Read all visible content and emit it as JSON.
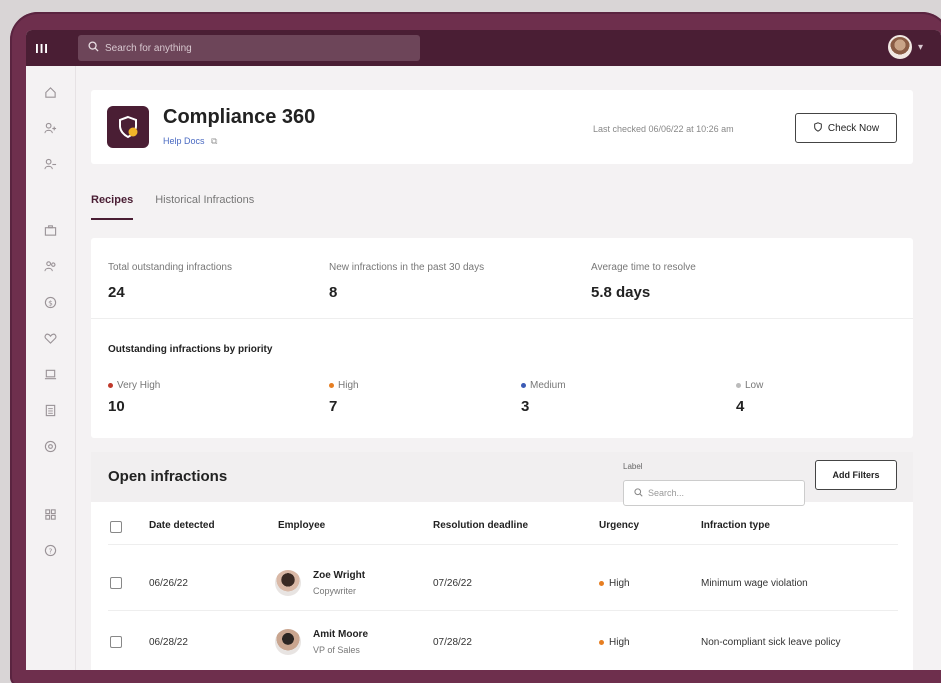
{
  "topbar": {
    "logo": "III",
    "search_placeholder": "Search for anything"
  },
  "sidebar": {
    "icons": [
      "home-icon",
      "add-person-icon",
      "remove-person-icon",
      "briefcase-icon",
      "people-icon",
      "dollar-icon",
      "heart-icon",
      "laptop-icon",
      "document-icon",
      "settings-icon",
      "reports-icon",
      "help-icon"
    ]
  },
  "header": {
    "title": "Compliance 360",
    "help_link": "Help Docs",
    "last_checked": "Last checked 06/06/22 at 10:26 am",
    "check_now_label": "Check Now"
  },
  "tabs": [
    {
      "label": "Recipes",
      "active": true
    },
    {
      "label": "Historical Infractions",
      "active": false
    }
  ],
  "stats": {
    "total_label": "Total outstanding infractions",
    "total_value": "24",
    "new_label": "New infractions in the past 30 days",
    "new_value": "8",
    "avg_label": "Average time to resolve",
    "avg_value": "5.8 days"
  },
  "priority": {
    "title": "Outstanding infractions by priority",
    "items": [
      {
        "label": "Very High",
        "value": "10",
        "color": "#c0392b"
      },
      {
        "label": "High",
        "value": "7",
        "color": "#e67e22"
      },
      {
        "label": "Medium",
        "value": "3",
        "color": "#3b5bb5"
      },
      {
        "label": "Low",
        "value": "4",
        "color": "#bbbbbb"
      }
    ]
  },
  "infractions": {
    "title": "Open infractions",
    "filter_label": "Label",
    "search_placeholder": "Search...",
    "add_filters_label": "Add Filters",
    "columns": [
      "Date detected",
      "Employee",
      "Resolution deadline",
      "Urgency",
      "Infraction type"
    ],
    "rows": [
      {
        "date": "06/26/22",
        "name": "Zoe Wright",
        "role": "Copywriter",
        "deadline": "07/26/22",
        "urgency": "High",
        "type": "Minimum wage violation"
      },
      {
        "date": "06/28/22",
        "name": "Amit Moore",
        "role": "VP of Sales",
        "deadline": "07/28/22",
        "urgency": "High",
        "type": "Non-compliant sick leave policy"
      }
    ],
    "urgency_color": "#e67e22"
  }
}
